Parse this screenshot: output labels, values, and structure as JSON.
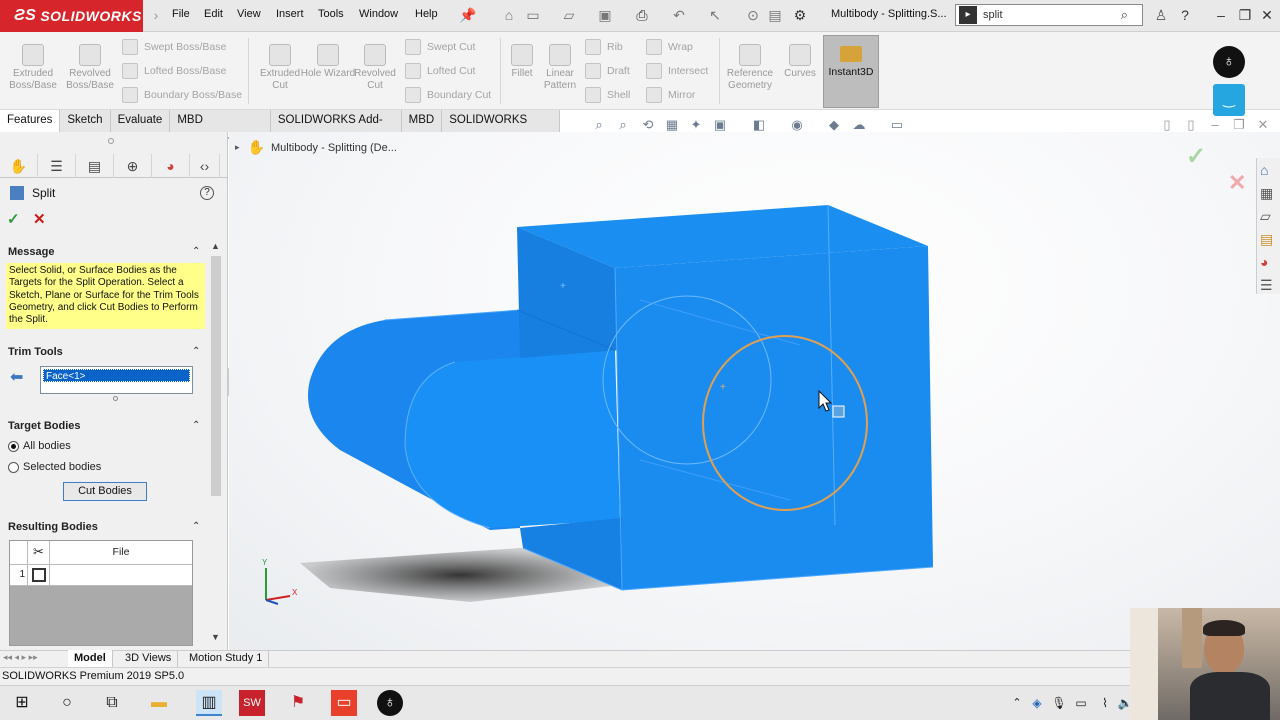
{
  "app": {
    "brand": "SOLIDWORKS",
    "brand_color": "#d6262c"
  },
  "menu": [
    "File",
    "Edit",
    "View",
    "Insert",
    "Tools",
    "Window",
    "Help"
  ],
  "document_title": "Multibody - Splitting.S...",
  "search": {
    "value": "split"
  },
  "ribbon": {
    "extruded_boss": "Extruded Boss/Base",
    "revolved_boss": "Revolved Boss/Base",
    "swept_boss": "Swept Boss/Base",
    "lofted_boss": "Lofted Boss/Base",
    "boundary_boss": "Boundary Boss/Base",
    "extruded_cut": "Extruded Cut",
    "hole_wizard": "Hole Wizard",
    "revolved_cut": "Revolved Cut",
    "swept_cut": "Swept Cut",
    "lofted_cut": "Lofted Cut",
    "boundary_cut": "Boundary Cut",
    "fillet": "Fillet",
    "linear_pattern": "Linear Pattern",
    "rib": "Rib",
    "draft": "Draft",
    "shell": "Shell",
    "wrap": "Wrap",
    "intersect": "Intersect",
    "mirror": "Mirror",
    "reference_geometry": "Reference Geometry",
    "curves": "Curves",
    "instant3d": "Instant3D"
  },
  "tabs": [
    "Features",
    "Sketch",
    "Evaluate",
    "MBD Dimensions",
    "SOLIDWORKS Add-Ins",
    "MBD",
    "SOLIDWORKS CAM"
  ],
  "property_manager": {
    "title": "Split",
    "message_header": "Message",
    "message": "Select Solid, or Surface Bodies as the Targets for the Split Operation. Select a Sketch, Plane or Surface for the Trim Tools Geometry, and click Cut Bodies to Perform the Split.",
    "trim_tools_header": "Trim Tools",
    "trim_selection": "Face<1>",
    "target_bodies_header": "Target Bodies",
    "all_bodies": "All bodies",
    "selected_bodies": "Selected bodies",
    "cut_bodies": "Cut Bodies",
    "resulting_bodies_header": "Resulting Bodies",
    "grid_col_file": "File",
    "grid_row_1": "1"
  },
  "breadcrumb": "Multibody - Splitting  (De...",
  "bottom_tabs": [
    "Model",
    "3D Views",
    "Motion Study 1"
  ],
  "status": "SOLIDWORKS Premium 2019 SP5.0",
  "axes": {
    "x": "X",
    "y": "Y"
  },
  "colors": {
    "part_blue": "#1a8cf0",
    "selection_orange": "#e0a050",
    "message_yellow": "#ffff8a"
  }
}
